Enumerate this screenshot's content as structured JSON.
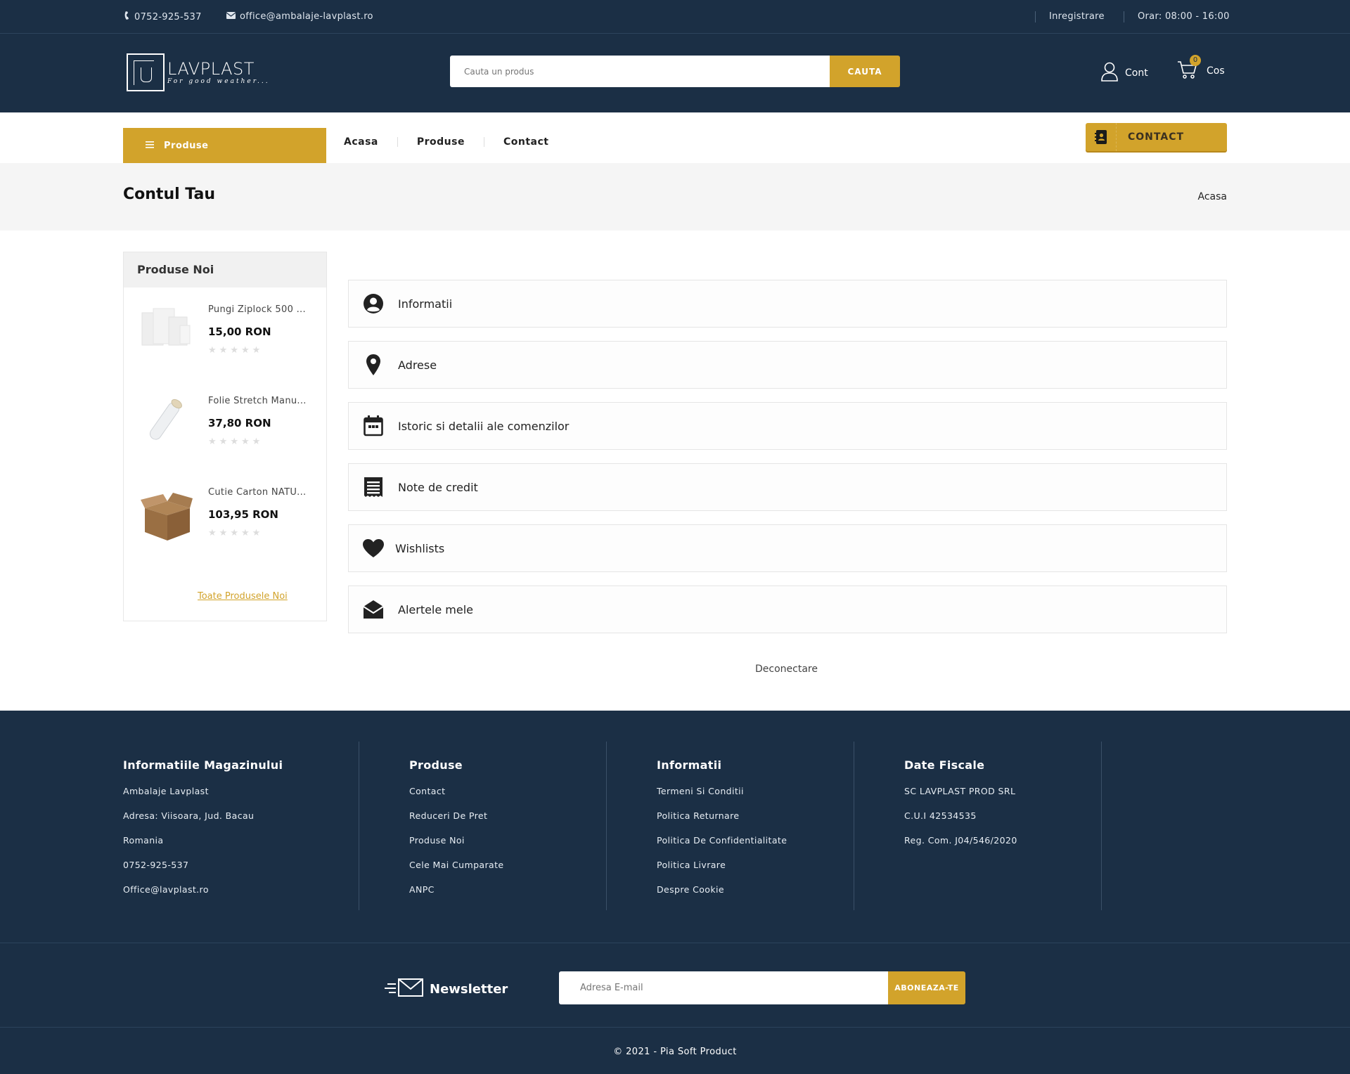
{
  "topbar": {
    "phone": "0752-925-537",
    "email": "office@ambalaje-lavplast.ro",
    "register": "Inregistrare",
    "hours": "Orar: 08:00 - 16:00"
  },
  "header": {
    "logo_name": "LAVPLAST",
    "logo_tagline": "For good weather...",
    "search_placeholder": "Cauta un produs",
    "search_button": "CAUTA",
    "account_label": "Cont",
    "cart_label": "Cos",
    "cart_count": "0"
  },
  "nav": {
    "category_button": "Produse",
    "links": [
      "Acasa",
      "Produse",
      "Contact"
    ],
    "contact_button": "CONTACT"
  },
  "band": {
    "title": "Contul Tau",
    "breadcrumb": "Acasa"
  },
  "sidebar": {
    "title": "Produse Noi",
    "items": [
      {
        "name": "Pungi Ziplock 500 ...",
        "price": "15,00 RON",
        "rating": 0
      },
      {
        "name": "Folie Stretch Manu...",
        "price": "37,80 RON",
        "rating": 0
      },
      {
        "name": "Cutie Carton NATU...",
        "price": "103,95 RON",
        "rating": 0
      }
    ],
    "all_link": "Toate Produsele Noi"
  },
  "account": {
    "tiles": [
      {
        "label": "Informatii",
        "icon": "user-circle-icon"
      },
      {
        "label": "Adrese",
        "icon": "map-pin-icon"
      },
      {
        "label": "Istoric si detalii ale comenzilor",
        "icon": "calendar-icon"
      },
      {
        "label": "Note de credit",
        "icon": "receipt-icon"
      },
      {
        "label": "Wishlists",
        "icon": "heart-icon"
      },
      {
        "label": "Alertele mele",
        "icon": "envelope-open-icon"
      }
    ],
    "logout": "Deconectare"
  },
  "footer": {
    "columns": [
      {
        "title": "Informatiile Magazinului",
        "items": [
          "Ambalaje Lavplast",
          "Adresa: Viisoara, Jud. Bacau",
          "Romania",
          "0752-925-537",
          "Office@lavplast.ro"
        ]
      },
      {
        "title": "Produse",
        "items": [
          "Contact",
          "Reduceri De Pret",
          "Produse Noi",
          "Cele Mai Cumparate",
          "ANPC"
        ]
      },
      {
        "title": "Informatii",
        "items": [
          "Termeni Si Conditii",
          "Politica Returnare",
          "Politica De Confidentialitate",
          "Politica Livrare",
          "Despre Cookie"
        ]
      },
      {
        "title": "Date Fiscale",
        "items": [
          "SC LAVPLAST PROD SRL",
          "C.U.I 42534535",
          "Reg. Com. J04/546/2020"
        ]
      }
    ],
    "newsletter_title": "Newsletter",
    "newsletter_placeholder": "Adresa E-mail",
    "newsletter_button": "ABONEAZA-TE",
    "copyright": "© 2021 - Pia Soft Product"
  },
  "colors": {
    "navy": "#1b2f45",
    "gold": "#d2a32b"
  }
}
